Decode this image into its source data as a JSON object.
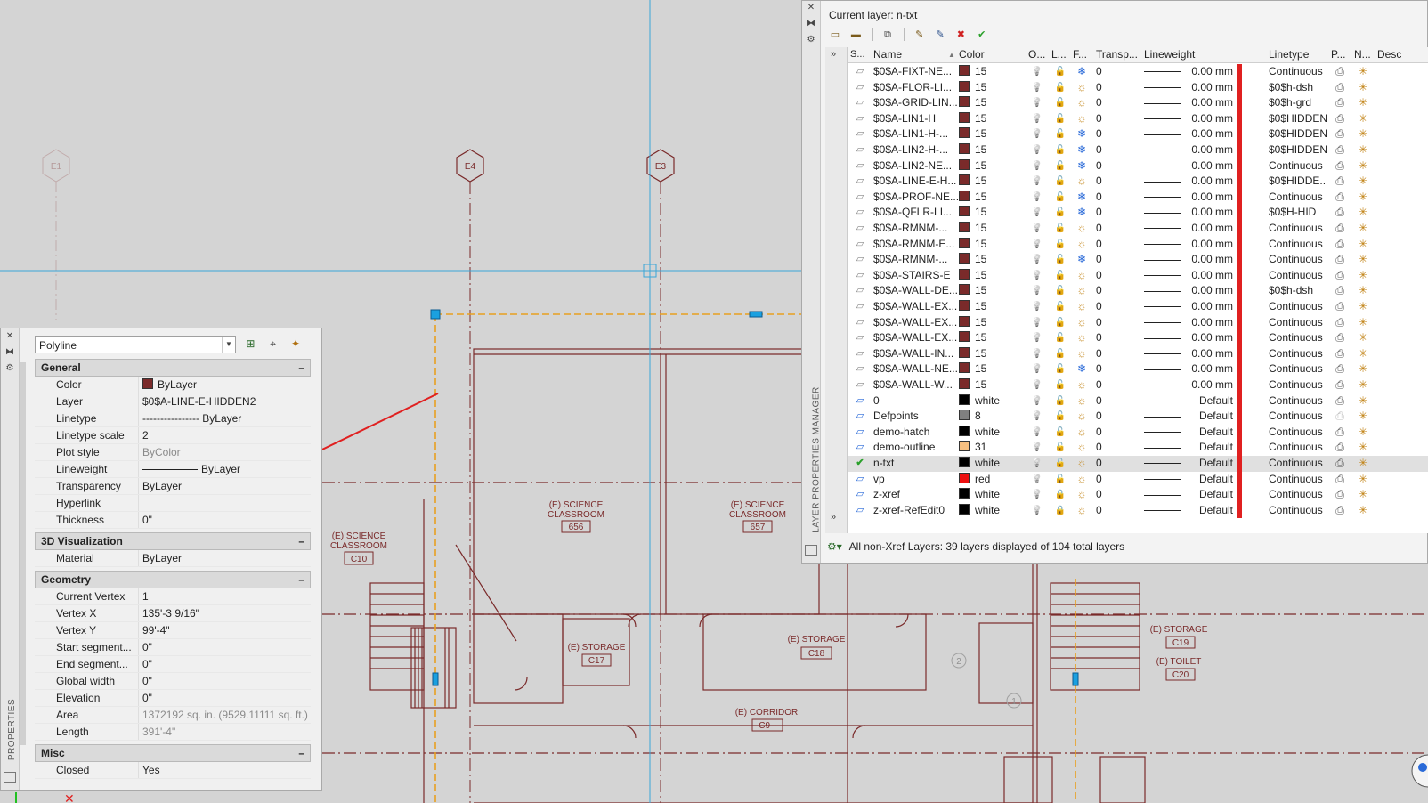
{
  "drawing": {
    "grid_bubbles": [
      "E1",
      "E4",
      "E3"
    ],
    "rooms": [
      {
        "name_line1": "(E) SCIENCE",
        "name_line2": "CLASSROOM",
        "number": "C10"
      },
      {
        "name_line1": "(E) SCIENCE",
        "name_line2": "CLASSROOM",
        "number": "656"
      },
      {
        "name_line1": "(E) SCIENCE",
        "name_line2": "CLASSROOM",
        "number": "657"
      },
      {
        "name_line1": "(E) STORAGE",
        "number": "C17"
      },
      {
        "name_line1": "(E) STORAGE",
        "number": "C18"
      },
      {
        "name_line1": "(E) CORRIDOR",
        "number": "C9--"
      },
      {
        "name_line1": "(E) STORAGE",
        "number": "C19"
      },
      {
        "name_line1": "(E) TOILET",
        "number": "C20"
      }
    ],
    "small_markers": [
      "2",
      "1"
    ],
    "colors": {
      "background": "#d4d4d4",
      "lines": "#7a2a2a",
      "selection": "#e8a020",
      "crosshair": "#3aa6d8",
      "arrow": "#e02020"
    }
  },
  "properties": {
    "title": "PROPERTIES",
    "object_type": "Polyline",
    "sections": [
      {
        "title": "General",
        "rows": [
          {
            "key": "Color",
            "value": "ByLayer",
            "swatch": "#7a2a2a"
          },
          {
            "key": "Layer",
            "value": "$0$A-LINE-E-HIDDEN2"
          },
          {
            "key": "Linetype",
            "value": "---------------- ByLayer"
          },
          {
            "key": "Linetype scale",
            "value": "2"
          },
          {
            "key": "Plot style",
            "value": "ByColor",
            "muted": true
          },
          {
            "key": "Lineweight",
            "value": "ByLayer",
            "lwline": true
          },
          {
            "key": "Transparency",
            "value": "ByLayer"
          },
          {
            "key": "Hyperlink",
            "value": ""
          },
          {
            "key": "Thickness",
            "value": "0\""
          }
        ]
      },
      {
        "title": "3D Visualization",
        "rows": [
          {
            "key": "Material",
            "value": "ByLayer"
          }
        ]
      },
      {
        "title": "Geometry",
        "rows": [
          {
            "key": "Current Vertex",
            "value": "1"
          },
          {
            "key": "Vertex X",
            "value": "135'-3 9/16\""
          },
          {
            "key": "Vertex Y",
            "value": "99'-4\""
          },
          {
            "key": "Start  segment...",
            "value": "0\""
          },
          {
            "key": "End  segment...",
            "value": "0\""
          },
          {
            "key": "Global width",
            "value": "0\""
          },
          {
            "key": "Elevation",
            "value": "0\""
          },
          {
            "key": "Area",
            "value": "1372192 sq. in. (9529.11111 sq. ft.)",
            "muted": true
          },
          {
            "key": "Length",
            "value": "391'-4\"",
            "muted": true
          }
        ]
      },
      {
        "title": "Misc",
        "rows": [
          {
            "key": "Closed",
            "value": "Yes"
          }
        ]
      }
    ]
  },
  "layer_manager": {
    "title": "LAYER PROPERTIES MANAGER",
    "current_layer": "Current layer: n-txt",
    "columns": {
      "status": "S...",
      "name": "Name",
      "color": "Color",
      "on": "O...",
      "lock": "L...",
      "freeze": "F...",
      "transparency": "Transp...",
      "lineweight": "Lineweight",
      "linetype": "Linetype",
      "plot": "P...",
      "newvp": "N...",
      "desc": "Desc"
    },
    "layers": [
      {
        "name": "$0$A-FIXT-NE...",
        "color": "15",
        "swatch": "#7a2a2a",
        "freeze": "frozen",
        "transparency": "0",
        "lineweight": "0.00 mm",
        "linetype": "Continuous"
      },
      {
        "name": "$0$A-FLOR-LI...",
        "color": "15",
        "swatch": "#7a2a2a",
        "freeze": "thawed",
        "transparency": "0",
        "lineweight": "0.00 mm",
        "linetype": "$0$h-dsh"
      },
      {
        "name": "$0$A-GRID-LIN...",
        "color": "15",
        "swatch": "#7a2a2a",
        "freeze": "thawed",
        "transparency": "0",
        "lineweight": "0.00 mm",
        "linetype": "$0$h-grd"
      },
      {
        "name": "$0$A-LIN1-H",
        "color": "15",
        "swatch": "#7a2a2a",
        "freeze": "thawed",
        "transparency": "0",
        "lineweight": "0.00 mm",
        "linetype": "$0$HIDDEN"
      },
      {
        "name": "$0$A-LIN1-H-...",
        "color": "15",
        "swatch": "#7a2a2a",
        "freeze": "frozen",
        "transparency": "0",
        "lineweight": "0.00 mm",
        "linetype": "$0$HIDDEN"
      },
      {
        "name": "$0$A-LIN2-H-...",
        "color": "15",
        "swatch": "#7a2a2a",
        "freeze": "frozen",
        "transparency": "0",
        "lineweight": "0.00 mm",
        "linetype": "$0$HIDDEN"
      },
      {
        "name": "$0$A-LIN2-NE...",
        "color": "15",
        "swatch": "#7a2a2a",
        "freeze": "frozen",
        "transparency": "0",
        "lineweight": "0.00 mm",
        "linetype": "Continuous"
      },
      {
        "name": "$0$A-LINE-E-H...",
        "color": "15",
        "swatch": "#7a2a2a",
        "freeze": "thawed",
        "transparency": "0",
        "lineweight": "0.00 mm",
        "linetype": "$0$HIDDE..."
      },
      {
        "name": "$0$A-PROF-NE...",
        "color": "15",
        "swatch": "#7a2a2a",
        "freeze": "frozen",
        "transparency": "0",
        "lineweight": "0.00 mm",
        "linetype": "Continuous"
      },
      {
        "name": "$0$A-QFLR-LI...",
        "color": "15",
        "swatch": "#7a2a2a",
        "freeze": "frozen",
        "transparency": "0",
        "lineweight": "0.00 mm",
        "linetype": "$0$H-HID"
      },
      {
        "name": "$0$A-RMNM-...",
        "color": "15",
        "swatch": "#7a2a2a",
        "freeze": "thawed",
        "transparency": "0",
        "lineweight": "0.00 mm",
        "linetype": "Continuous"
      },
      {
        "name": "$0$A-RMNM-E...",
        "color": "15",
        "swatch": "#7a2a2a",
        "freeze": "thawed",
        "transparency": "0",
        "lineweight": "0.00 mm",
        "linetype": "Continuous"
      },
      {
        "name": "$0$A-RMNM-...",
        "color": "15",
        "swatch": "#7a2a2a",
        "freeze": "frozen",
        "transparency": "0",
        "lineweight": "0.00 mm",
        "linetype": "Continuous"
      },
      {
        "name": "$0$A-STAIRS-E",
        "color": "15",
        "swatch": "#7a2a2a",
        "freeze": "thawed",
        "transparency": "0",
        "lineweight": "0.00 mm",
        "linetype": "Continuous"
      },
      {
        "name": "$0$A-WALL-DE...",
        "color": "15",
        "swatch": "#7a2a2a",
        "freeze": "thawed",
        "transparency": "0",
        "lineweight": "0.00 mm",
        "linetype": "$0$h-dsh"
      },
      {
        "name": "$0$A-WALL-EX...",
        "color": "15",
        "swatch": "#7a2a2a",
        "freeze": "thawed",
        "transparency": "0",
        "lineweight": "0.00 mm",
        "linetype": "Continuous"
      },
      {
        "name": "$0$A-WALL-EX...",
        "color": "15",
        "swatch": "#7a2a2a",
        "freeze": "thawed",
        "transparency": "0",
        "lineweight": "0.00 mm",
        "linetype": "Continuous"
      },
      {
        "name": "$0$A-WALL-EX...",
        "color": "15",
        "swatch": "#7a2a2a",
        "freeze": "thawed",
        "transparency": "0",
        "lineweight": "0.00 mm",
        "linetype": "Continuous"
      },
      {
        "name": "$0$A-WALL-IN...",
        "color": "15",
        "swatch": "#7a2a2a",
        "freeze": "thawed",
        "transparency": "0",
        "lineweight": "0.00 mm",
        "linetype": "Continuous"
      },
      {
        "name": "$0$A-WALL-NE...",
        "color": "15",
        "swatch": "#7a2a2a",
        "freeze": "frozen",
        "transparency": "0",
        "lineweight": "0.00 mm",
        "linetype": "Continuous"
      },
      {
        "name": "$0$A-WALL-W...",
        "color": "15",
        "swatch": "#7a2a2a",
        "freeze": "thawed",
        "transparency": "0",
        "lineweight": "0.00 mm",
        "linetype": "Continuous"
      },
      {
        "name": "0",
        "color": "white",
        "swatch": "#000000",
        "freeze": "thawed",
        "transparency": "0",
        "lineweight": "Default",
        "linetype": "Continuous"
      },
      {
        "name": "Defpoints",
        "color": "8",
        "swatch": "#808080",
        "freeze": "thawed",
        "transparency": "0",
        "lineweight": "Default",
        "linetype": "Continuous"
      },
      {
        "name": "demo-hatch",
        "color": "white",
        "swatch": "#000000",
        "freeze": "thawed",
        "transparency": "0",
        "lineweight": "Default",
        "linetype": "Continuous"
      },
      {
        "name": "demo-outline",
        "color": "31",
        "swatch": "#f8c080",
        "freeze": "thawed",
        "transparency": "0",
        "lineweight": "Default",
        "linetype": "Continuous"
      },
      {
        "name": "n-txt",
        "color": "white",
        "swatch": "#000000",
        "freeze": "thawed",
        "transparency": "0",
        "lineweight": "Default",
        "linetype": "Continuous",
        "current": true
      },
      {
        "name": "vp",
        "color": "red",
        "swatch": "#ee1111",
        "freeze": "thawed",
        "transparency": "0",
        "lineweight": "Default",
        "linetype": "Continuous"
      },
      {
        "name": "z-xref",
        "color": "white",
        "swatch": "#000000",
        "freeze": "thawed",
        "transparency": "0",
        "lineweight": "Default",
        "linetype": "Continuous"
      },
      {
        "name": "z-xref-RefEdit0",
        "color": "white",
        "swatch": "#000000",
        "freeze": "thawed",
        "transparency": "0",
        "lineweight": "Default",
        "linetype": "Continuous"
      }
    ],
    "status": "All non-Xref Layers: 39 layers displayed of 104 total layers"
  }
}
